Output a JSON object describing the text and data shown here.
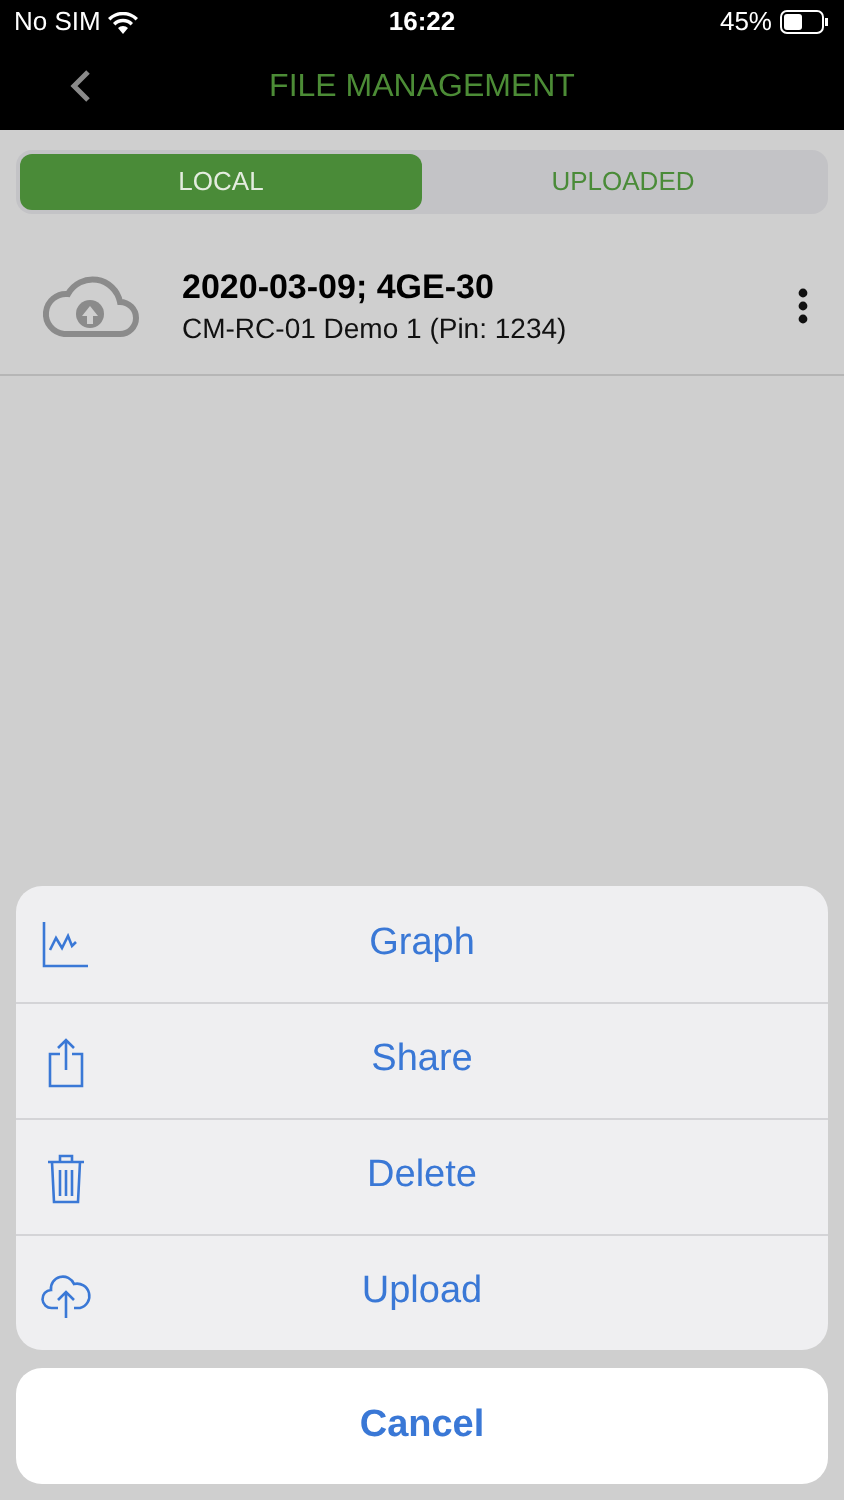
{
  "status_bar": {
    "carrier": "No SIM",
    "time": "16:22",
    "battery": "45%"
  },
  "nav": {
    "title": "FILE MANAGEMENT"
  },
  "tabs": [
    {
      "label": "LOCAL",
      "selected": true
    },
    {
      "label": "UPLOADED",
      "selected": false
    }
  ],
  "files": [
    {
      "title": "2020-03-09; 4GE-30",
      "subtitle": "CM-RC-01 Demo 1 (Pin: 1234)"
    }
  ],
  "action_sheet": {
    "actions": [
      {
        "kind": "graph",
        "label": "Graph"
      },
      {
        "kind": "share",
        "label": "Share"
      },
      {
        "kind": "delete",
        "label": "Delete"
      },
      {
        "kind": "upload",
        "label": "Upload"
      }
    ],
    "cancel": "Cancel"
  }
}
